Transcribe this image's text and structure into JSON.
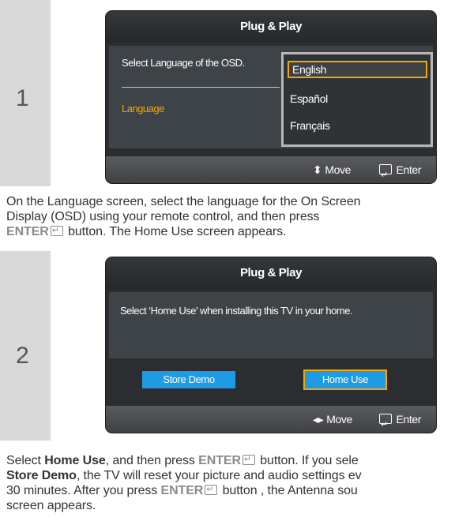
{
  "steps": [
    {
      "number": "1",
      "screen": {
        "title": "Plug & Play",
        "prompt": "Select Language of the OSD.",
        "field_label": "Language",
        "options": [
          "English",
          "Español",
          "Français"
        ],
        "selected_option": "English",
        "footer": {
          "move": "Move",
          "enter": "Enter"
        }
      }
    },
    {
      "number": "2",
      "screen": {
        "title": "Plug & Play",
        "prompt": "Select ‘Home Use’ when installing this TV in your home.",
        "buttons": [
          "Store Demo",
          "Home Use"
        ],
        "selected_button": "Home Use",
        "footer": {
          "move": "Move",
          "enter": "Enter"
        }
      }
    }
  ],
  "paragraphs": {
    "p1": {
      "line1": "On the Language screen, select the language for the On Screen",
      "line2": "Display (OSD) using your remote control, and then press",
      "enter": "ENTER",
      "line3_rest": " button. The Home Use screen appears."
    },
    "p2": {
      "l1_a": "Select ",
      "l1_bold": "Home Use",
      "l1_b": ", and then press ",
      "l1_enter": "ENTER",
      "l1_c": " button. If you sele",
      "l2_bold": "Store Demo",
      "l2_rest": ", the TV will reset your picture and audio settings ev",
      "l3_a": "30 minutes. After you press ",
      "l3_enter": "ENTER",
      "l3_rest": " button , the Antenna sou",
      "l4": "screen appears."
    }
  },
  "colors": {
    "accent": "#f5a800",
    "button": "#1f9be5",
    "number_bg": "#d9d9d9"
  },
  "icons": {
    "updown": "up-down-arrows-icon",
    "leftright": "left-right-arrows-icon",
    "enter": "enter-key-icon"
  }
}
